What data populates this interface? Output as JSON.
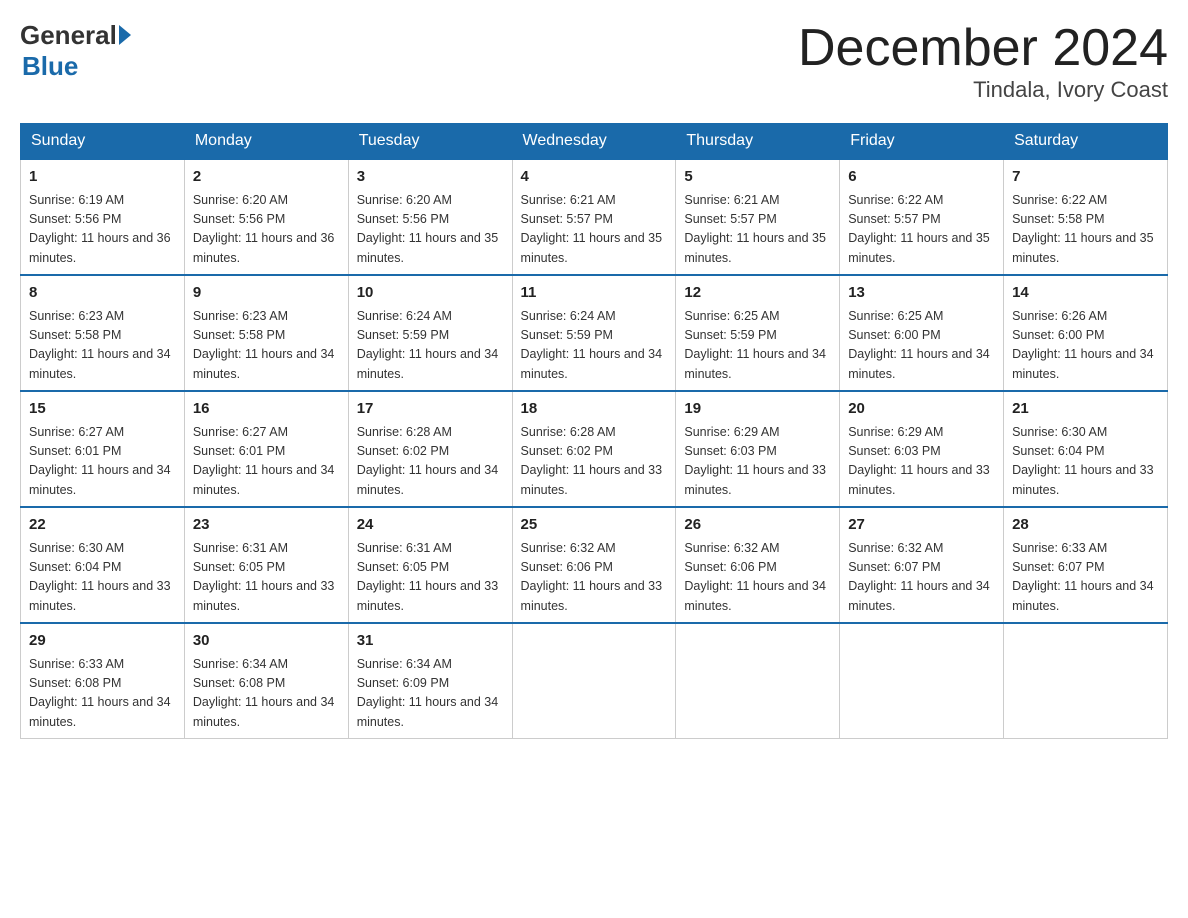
{
  "logo": {
    "general": "General",
    "blue": "Blue",
    "subtitle": "Blue"
  },
  "header": {
    "month_year": "December 2024",
    "location": "Tindala, Ivory Coast"
  },
  "days_of_week": [
    "Sunday",
    "Monday",
    "Tuesday",
    "Wednesday",
    "Thursday",
    "Friday",
    "Saturday"
  ],
  "weeks": [
    [
      {
        "day": "1",
        "sunrise": "Sunrise: 6:19 AM",
        "sunset": "Sunset: 5:56 PM",
        "daylight": "Daylight: 11 hours and 36 minutes."
      },
      {
        "day": "2",
        "sunrise": "Sunrise: 6:20 AM",
        "sunset": "Sunset: 5:56 PM",
        "daylight": "Daylight: 11 hours and 36 minutes."
      },
      {
        "day": "3",
        "sunrise": "Sunrise: 6:20 AM",
        "sunset": "Sunset: 5:56 PM",
        "daylight": "Daylight: 11 hours and 35 minutes."
      },
      {
        "day": "4",
        "sunrise": "Sunrise: 6:21 AM",
        "sunset": "Sunset: 5:57 PM",
        "daylight": "Daylight: 11 hours and 35 minutes."
      },
      {
        "day": "5",
        "sunrise": "Sunrise: 6:21 AM",
        "sunset": "Sunset: 5:57 PM",
        "daylight": "Daylight: 11 hours and 35 minutes."
      },
      {
        "day": "6",
        "sunrise": "Sunrise: 6:22 AM",
        "sunset": "Sunset: 5:57 PM",
        "daylight": "Daylight: 11 hours and 35 minutes."
      },
      {
        "day": "7",
        "sunrise": "Sunrise: 6:22 AM",
        "sunset": "Sunset: 5:58 PM",
        "daylight": "Daylight: 11 hours and 35 minutes."
      }
    ],
    [
      {
        "day": "8",
        "sunrise": "Sunrise: 6:23 AM",
        "sunset": "Sunset: 5:58 PM",
        "daylight": "Daylight: 11 hours and 34 minutes."
      },
      {
        "day": "9",
        "sunrise": "Sunrise: 6:23 AM",
        "sunset": "Sunset: 5:58 PM",
        "daylight": "Daylight: 11 hours and 34 minutes."
      },
      {
        "day": "10",
        "sunrise": "Sunrise: 6:24 AM",
        "sunset": "Sunset: 5:59 PM",
        "daylight": "Daylight: 11 hours and 34 minutes."
      },
      {
        "day": "11",
        "sunrise": "Sunrise: 6:24 AM",
        "sunset": "Sunset: 5:59 PM",
        "daylight": "Daylight: 11 hours and 34 minutes."
      },
      {
        "day": "12",
        "sunrise": "Sunrise: 6:25 AM",
        "sunset": "Sunset: 5:59 PM",
        "daylight": "Daylight: 11 hours and 34 minutes."
      },
      {
        "day": "13",
        "sunrise": "Sunrise: 6:25 AM",
        "sunset": "Sunset: 6:00 PM",
        "daylight": "Daylight: 11 hours and 34 minutes."
      },
      {
        "day": "14",
        "sunrise": "Sunrise: 6:26 AM",
        "sunset": "Sunset: 6:00 PM",
        "daylight": "Daylight: 11 hours and 34 minutes."
      }
    ],
    [
      {
        "day": "15",
        "sunrise": "Sunrise: 6:27 AM",
        "sunset": "Sunset: 6:01 PM",
        "daylight": "Daylight: 11 hours and 34 minutes."
      },
      {
        "day": "16",
        "sunrise": "Sunrise: 6:27 AM",
        "sunset": "Sunset: 6:01 PM",
        "daylight": "Daylight: 11 hours and 34 minutes."
      },
      {
        "day": "17",
        "sunrise": "Sunrise: 6:28 AM",
        "sunset": "Sunset: 6:02 PM",
        "daylight": "Daylight: 11 hours and 34 minutes."
      },
      {
        "day": "18",
        "sunrise": "Sunrise: 6:28 AM",
        "sunset": "Sunset: 6:02 PM",
        "daylight": "Daylight: 11 hours and 33 minutes."
      },
      {
        "day": "19",
        "sunrise": "Sunrise: 6:29 AM",
        "sunset": "Sunset: 6:03 PM",
        "daylight": "Daylight: 11 hours and 33 minutes."
      },
      {
        "day": "20",
        "sunrise": "Sunrise: 6:29 AM",
        "sunset": "Sunset: 6:03 PM",
        "daylight": "Daylight: 11 hours and 33 minutes."
      },
      {
        "day": "21",
        "sunrise": "Sunrise: 6:30 AM",
        "sunset": "Sunset: 6:04 PM",
        "daylight": "Daylight: 11 hours and 33 minutes."
      }
    ],
    [
      {
        "day": "22",
        "sunrise": "Sunrise: 6:30 AM",
        "sunset": "Sunset: 6:04 PM",
        "daylight": "Daylight: 11 hours and 33 minutes."
      },
      {
        "day": "23",
        "sunrise": "Sunrise: 6:31 AM",
        "sunset": "Sunset: 6:05 PM",
        "daylight": "Daylight: 11 hours and 33 minutes."
      },
      {
        "day": "24",
        "sunrise": "Sunrise: 6:31 AM",
        "sunset": "Sunset: 6:05 PM",
        "daylight": "Daylight: 11 hours and 33 minutes."
      },
      {
        "day": "25",
        "sunrise": "Sunrise: 6:32 AM",
        "sunset": "Sunset: 6:06 PM",
        "daylight": "Daylight: 11 hours and 33 minutes."
      },
      {
        "day": "26",
        "sunrise": "Sunrise: 6:32 AM",
        "sunset": "Sunset: 6:06 PM",
        "daylight": "Daylight: 11 hours and 34 minutes."
      },
      {
        "day": "27",
        "sunrise": "Sunrise: 6:32 AM",
        "sunset": "Sunset: 6:07 PM",
        "daylight": "Daylight: 11 hours and 34 minutes."
      },
      {
        "day": "28",
        "sunrise": "Sunrise: 6:33 AM",
        "sunset": "Sunset: 6:07 PM",
        "daylight": "Daylight: 11 hours and 34 minutes."
      }
    ],
    [
      {
        "day": "29",
        "sunrise": "Sunrise: 6:33 AM",
        "sunset": "Sunset: 6:08 PM",
        "daylight": "Daylight: 11 hours and 34 minutes."
      },
      {
        "day": "30",
        "sunrise": "Sunrise: 6:34 AM",
        "sunset": "Sunset: 6:08 PM",
        "daylight": "Daylight: 11 hours and 34 minutes."
      },
      {
        "day": "31",
        "sunrise": "Sunrise: 6:34 AM",
        "sunset": "Sunset: 6:09 PM",
        "daylight": "Daylight: 11 hours and 34 minutes."
      },
      null,
      null,
      null,
      null
    ]
  ]
}
